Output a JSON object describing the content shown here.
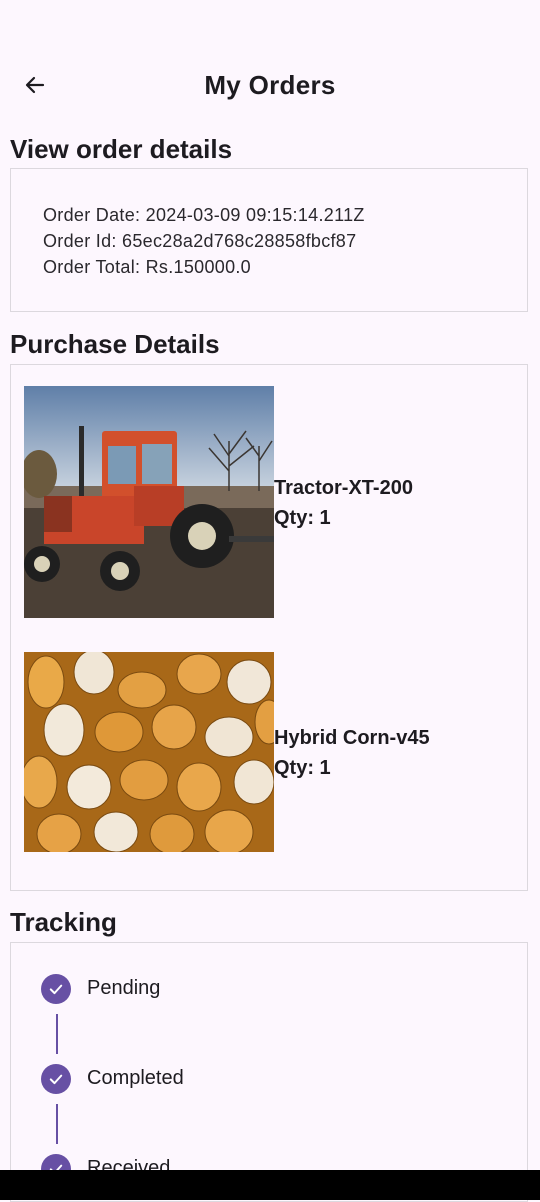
{
  "appbar": {
    "title": "My Orders",
    "back_icon": "arrow-left-icon"
  },
  "order_details": {
    "heading": "View order details",
    "order_date": "Order Date: 2024-03-09 09:15:14.211Z",
    "order_id": "Order Id: 65ec28a2d768c28858fbcf87",
    "order_total": "Order Total: Rs.150000.0"
  },
  "purchase": {
    "heading": "Purchase Details",
    "items": [
      {
        "name": "Tractor-XT-200",
        "qty": "Qty: 1",
        "image": "tractor-image"
      },
      {
        "name": "Hybrid Corn-v45",
        "qty": "Qty: 1",
        "image": "corn-image"
      }
    ]
  },
  "tracking": {
    "heading": "Tracking",
    "steps": [
      {
        "label": "Pending",
        "icon": "check-icon"
      },
      {
        "label": "Completed",
        "icon": "check-icon"
      },
      {
        "label": "Received",
        "icon": "check-icon"
      }
    ]
  },
  "colors": {
    "accent": "#6750a4",
    "background": "#fdf7fe",
    "border": "#dcd8de"
  }
}
